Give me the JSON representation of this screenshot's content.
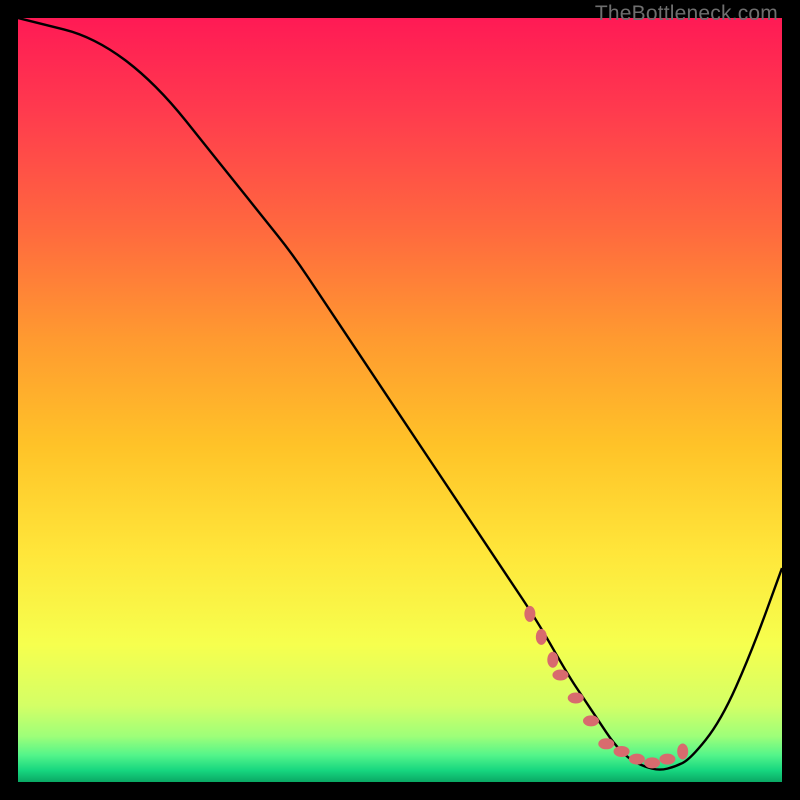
{
  "watermark": "TheBottleneck.com",
  "chart_data": {
    "type": "line",
    "title": "",
    "xlabel": "",
    "ylabel": "",
    "xlim": [
      0,
      100
    ],
    "ylim": [
      0,
      100
    ],
    "series": [
      {
        "name": "bottleneck-curve",
        "x": [
          0,
          4,
          8,
          12,
          16,
          20,
          24,
          28,
          32,
          36,
          40,
          44,
          48,
          52,
          56,
          60,
          64,
          68,
          72,
          74,
          76,
          78,
          80,
          82,
          84,
          86,
          88,
          92,
          96,
          100
        ],
        "values": [
          100,
          99,
          98,
          96,
          93,
          89,
          84,
          79,
          74,
          69,
          63,
          57,
          51,
          45,
          39,
          33,
          27,
          21,
          14,
          11,
          8,
          5,
          3,
          2,
          1.5,
          2,
          3,
          8,
          17,
          28
        ]
      }
    ],
    "markers": {
      "name": "highlight-dots",
      "x": [
        67,
        68.5,
        70,
        71,
        73,
        75,
        77,
        79,
        81,
        83,
        85,
        87
      ],
      "values": [
        22,
        19,
        16,
        14,
        11,
        8,
        5,
        4,
        3,
        2.5,
        3,
        4
      ]
    },
    "gradient_stops": [
      {
        "offset": 0.0,
        "color": "#ff1a55"
      },
      {
        "offset": 0.12,
        "color": "#ff3a4e"
      },
      {
        "offset": 0.28,
        "color": "#ff6a3e"
      },
      {
        "offset": 0.42,
        "color": "#ff9a30"
      },
      {
        "offset": 0.56,
        "color": "#ffc328"
      },
      {
        "offset": 0.7,
        "color": "#ffe63a"
      },
      {
        "offset": 0.82,
        "color": "#f6ff4e"
      },
      {
        "offset": 0.9,
        "color": "#d4ff66"
      },
      {
        "offset": 0.94,
        "color": "#9eff79"
      },
      {
        "offset": 0.965,
        "color": "#53f58a"
      },
      {
        "offset": 0.985,
        "color": "#16d67f"
      },
      {
        "offset": 1.0,
        "color": "#0aa864"
      }
    ],
    "marker_color": "#d86b6e",
    "curve_color": "#000000"
  }
}
